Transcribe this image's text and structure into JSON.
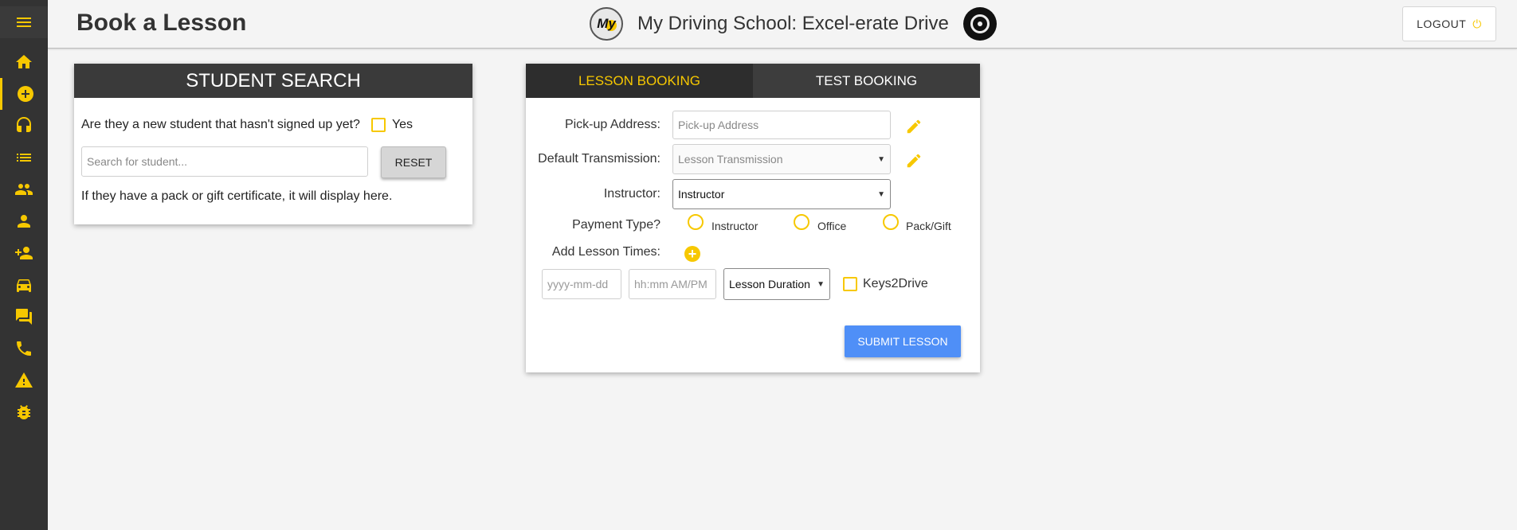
{
  "header": {
    "page_title": "Book a Lesson",
    "brand_name": "My Driving School: Excel-erate Drive",
    "logo_text": "My",
    "logout_label": "LOGOUT"
  },
  "sidebar": {
    "items": [
      {
        "name": "home-icon"
      },
      {
        "name": "add-circle-icon"
      },
      {
        "name": "headset-icon"
      },
      {
        "name": "list-icon"
      },
      {
        "name": "group-icon"
      },
      {
        "name": "person-icon"
      },
      {
        "name": "person-add-icon"
      },
      {
        "name": "car-icon"
      },
      {
        "name": "chat-icon"
      },
      {
        "name": "phone-icon"
      },
      {
        "name": "warning-icon"
      },
      {
        "name": "bug-icon"
      }
    ]
  },
  "student_search": {
    "title": "STUDENT SEARCH",
    "new_student_question": "Are they a new student that hasn't signed up yet?",
    "yes_label": "Yes",
    "search_placeholder": "Search for student...",
    "reset_label": "RESET",
    "info_text": "If they have a pack or gift certificate, it will display here."
  },
  "booking": {
    "tabs": [
      {
        "label": "LESSON BOOKING",
        "active": true
      },
      {
        "label": "TEST BOOKING",
        "active": false
      }
    ],
    "pickup_label": "Pick-up Address:",
    "pickup_placeholder": "Pick-up Address",
    "transmission_label": "Default Transmission:",
    "transmission_value": "Lesson Transmission",
    "instructor_label": "Instructor:",
    "instructor_value": "Instructor",
    "payment_label": "Payment Type?",
    "payment_options": [
      "Instructor",
      "Office",
      "Pack/Gift"
    ],
    "add_times_label": "Add Lesson Times:",
    "date_placeholder": "yyyy-mm-dd",
    "time_placeholder": "hh:mm AM/PM",
    "duration_value": "Lesson Duration",
    "keys2drive_label": "Keys2Drive",
    "submit_label": "SUBMIT LESSON"
  },
  "colors": {
    "accent": "#f7c800",
    "sidebar_bg": "#333333",
    "submit_blue": "#4f8ff7"
  }
}
